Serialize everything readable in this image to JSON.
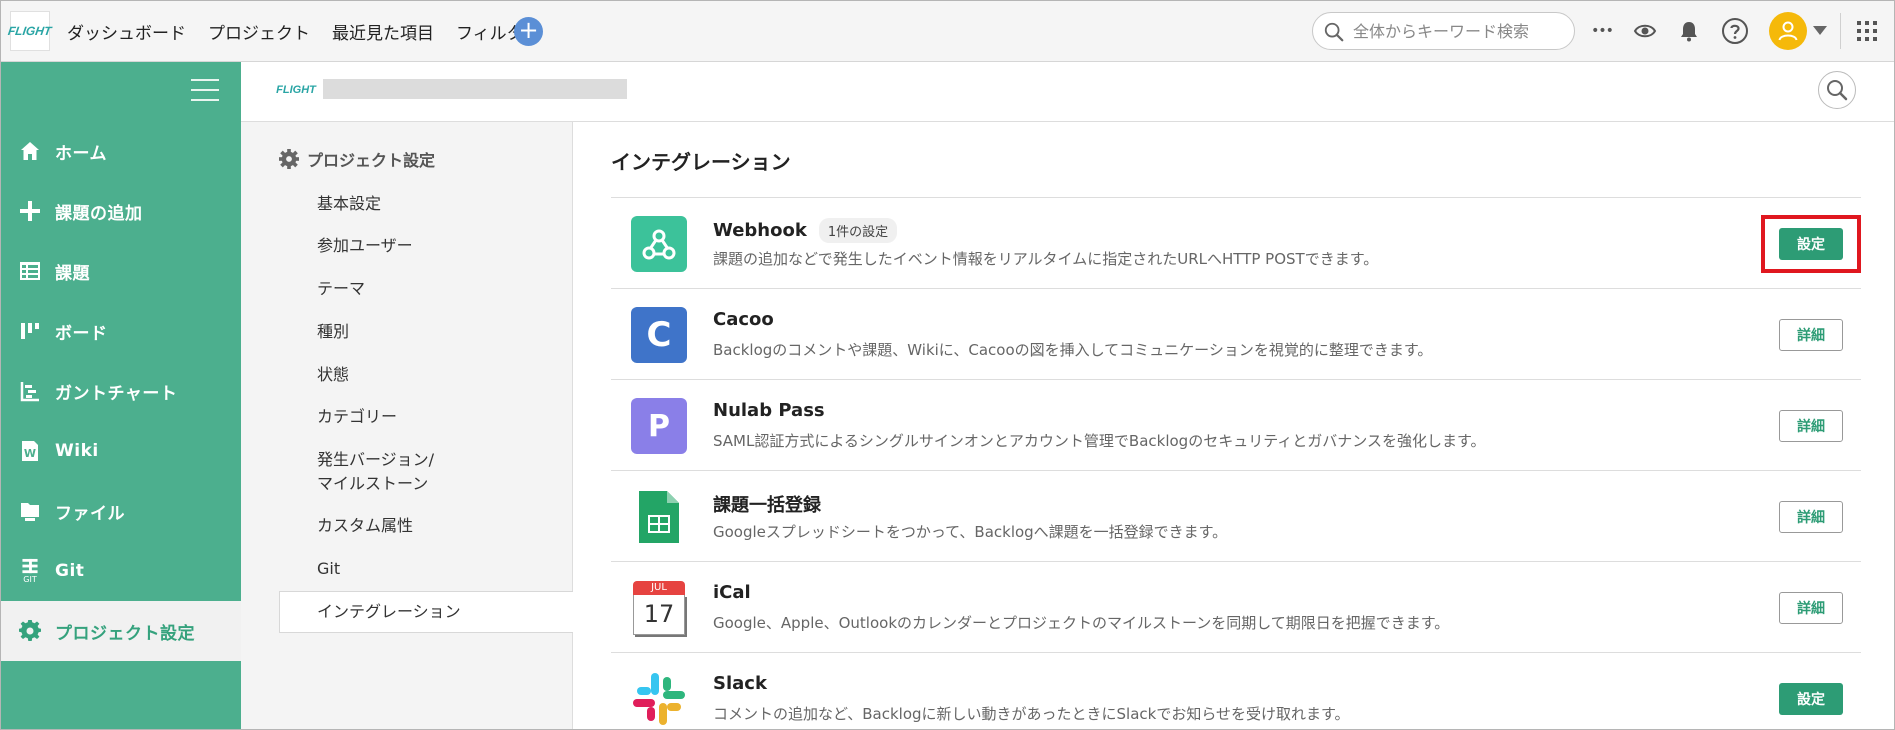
{
  "topbar": {
    "logo_text": "FLIGHT",
    "nav": [
      "ダッシュボード",
      "プロジェクト",
      "最近見た項目",
      "フィルタ"
    ],
    "add_label": "+",
    "search_placeholder": "全体からキーワード検索",
    "more_label": "•••"
  },
  "sidebar": {
    "items": [
      {
        "label": "ホーム",
        "icon": "home-icon"
      },
      {
        "label": "課題の追加",
        "icon": "plus-icon"
      },
      {
        "label": "課題",
        "icon": "list-icon"
      },
      {
        "label": "ボード",
        "icon": "board-icon"
      },
      {
        "label": "ガントチャート",
        "icon": "gantt-icon"
      },
      {
        "label": "Wiki",
        "icon": "wiki-icon"
      },
      {
        "label": "ファイル",
        "icon": "file-icon"
      },
      {
        "label": "Git",
        "icon": "git-icon",
        "sub": "GIT"
      },
      {
        "label": "プロジェクト設定",
        "icon": "gear-icon"
      }
    ]
  },
  "project_header": {
    "logo_text": "FLIGHT"
  },
  "settings_nav": {
    "title": "プロジェクト設定",
    "items": [
      "基本設定",
      "参加ユーザー",
      "テーマ",
      "種別",
      "状態",
      "カテゴリー",
      "発生バージョン/",
      "マイルストーン",
      "カスタム属性",
      "Git",
      "インテグレーション"
    ]
  },
  "main": {
    "title": "インテグレーション",
    "integrations": [
      {
        "name": "Webhook",
        "badge": "1件の設定",
        "desc": "課題の追加などで発生したイベント情報をリアルタイムに指定されたURLへHTTP POSTできます。",
        "button": "設定",
        "icon_text": ""
      },
      {
        "name": "Cacoo",
        "desc": "Backlogのコメントや課題、Wikiに、Cacooの図を挿入してコミュニケーションを視覚的に整理できます。",
        "button": "詳細",
        "icon_text": "C"
      },
      {
        "name": "Nulab Pass",
        "desc": "SAML認証方式によるシングルサインオンとアカウント管理でBacklogのセキュリティとガバナンスを強化します。",
        "button": "詳細",
        "icon_text": "P"
      },
      {
        "name": "課題一括登録",
        "desc": "Googleスプレッドシートをつかって、Backlogへ課題を一括登録できます。",
        "button": "詳細",
        "icon_text": ""
      },
      {
        "name": "iCal",
        "desc": "Google、Apple、Outlookのカレンダーとプロジェクトのマイルストーンを同期して期限日を把握できます。",
        "button": "詳細",
        "icon_text": "17",
        "icon_month": "JUL"
      },
      {
        "name": "Slack",
        "desc": "コメントの追加など、Backlogに新しい動きがあったときにSlackでお知らせを受け取れます。",
        "button": "設定",
        "icon_text": ""
      }
    ]
  },
  "colors": {
    "sidebar_green": "#4caf8e",
    "accent_green": "#2d9c75",
    "highlight_red": "#e0171f"
  }
}
